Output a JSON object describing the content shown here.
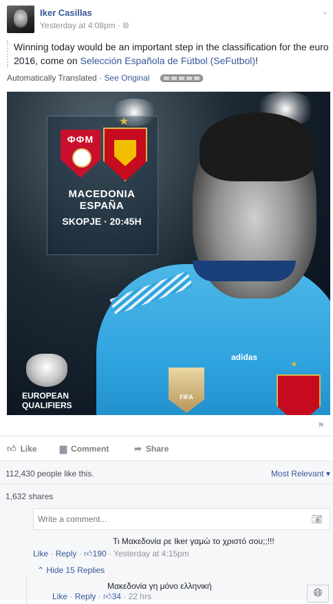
{
  "post": {
    "author": "Iker Casillas",
    "timestamp": "Yesterday at 4:08pm · ",
    "audience_icon": "globe-icon",
    "text_before": "Winning today would be an important step in the classification for the euro 2016, come on ",
    "text_link": "Selección Española de Fútbol (SeFutbol)",
    "text_after": "!",
    "translated_label": "Automatically Translated · ",
    "see_original": "See Original"
  },
  "photo": {
    "team_home_code": "ФФМ",
    "teams": "MACEDONIA  ESPAÑA",
    "venue": "SKOPJE · 20:45H",
    "brand": "adidas",
    "badge": "FIFA",
    "competition_line1": "EUROPEAN",
    "competition_line2": "QUALIFIERS"
  },
  "actions": {
    "like": "Like",
    "comment": "Comment",
    "share": "Share"
  },
  "stats": {
    "likes": "112,430 people like this.",
    "sort": "Most Relevant ▾",
    "shares": "1,632 shares"
  },
  "comment_input": {
    "placeholder": "Write a comment..."
  },
  "comments": [
    {
      "text": "Τι Μακεδονία ρε Iker γαμώ το χριστό σου;;!!!",
      "like": "Like",
      "reply": "Reply",
      "count": "190",
      "time": "Yesterday at 4:15pm"
    }
  ],
  "replies_toggle": "Hide 15 Replies",
  "reply": {
    "text": "Μακεδονία γη μόνο ελληνική",
    "like": "Like",
    "reply": "Reply",
    "count": "34",
    "time": "22 hrs"
  },
  "colors": {
    "link": "#365899",
    "muted": "#90949c",
    "shirt": "#2fa3de"
  }
}
